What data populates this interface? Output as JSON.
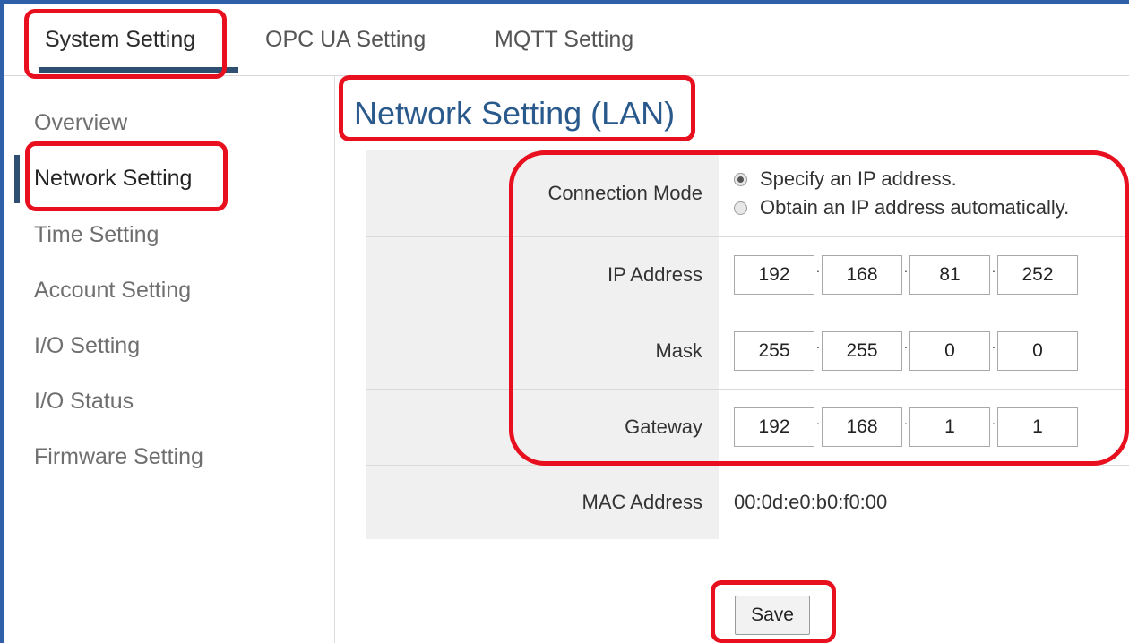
{
  "tabs": [
    {
      "label": "System Setting",
      "active": true
    },
    {
      "label": "OPC UA Setting",
      "active": false
    },
    {
      "label": "MQTT Setting",
      "active": false
    }
  ],
  "sidebar": {
    "items": [
      {
        "label": "Overview",
        "active": false
      },
      {
        "label": "Network Setting",
        "active": true
      },
      {
        "label": "Time Setting",
        "active": false
      },
      {
        "label": "Account Setting",
        "active": false
      },
      {
        "label": "I/O Setting",
        "active": false
      },
      {
        "label": "I/O Status",
        "active": false
      },
      {
        "label": "Firmware Setting",
        "active": false
      }
    ]
  },
  "page": {
    "title": "Network Setting (LAN)"
  },
  "form": {
    "connection_mode": {
      "label": "Connection Mode",
      "options": [
        "Specify an IP address.",
        "Obtain an IP address automatically."
      ],
      "selected_index": 0
    },
    "ip_address": {
      "label": "IP Address",
      "octets": [
        "192",
        "168",
        "81",
        "252"
      ]
    },
    "mask": {
      "label": "Mask",
      "octets": [
        "255",
        "255",
        "0",
        "0"
      ]
    },
    "gateway": {
      "label": "Gateway",
      "octets": [
        "192",
        "168",
        "1",
        "1"
      ]
    },
    "mac_address": {
      "label": "MAC Address",
      "value": "00:0d:e0:b0:f0:00"
    }
  },
  "actions": {
    "save_label": "Save"
  },
  "colors": {
    "highlight": "#e8101e",
    "title": "#2a5a8c",
    "frame": "#2e5fa8",
    "active_indicator": "#2f4f72"
  }
}
